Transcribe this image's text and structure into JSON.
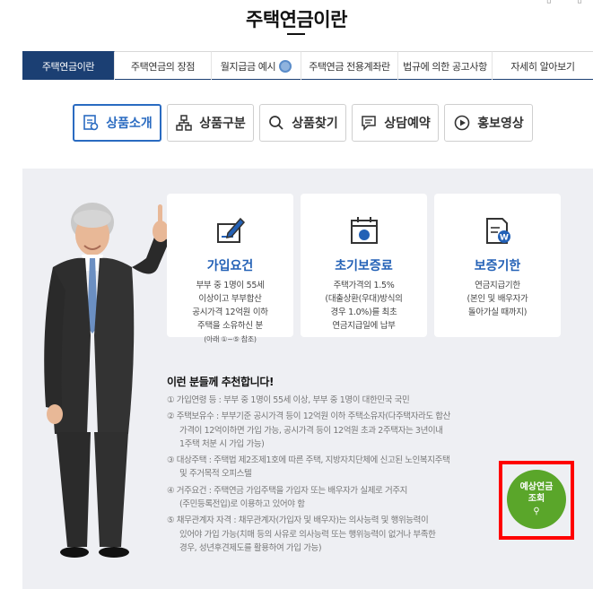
{
  "page": {
    "title": "주택연금이란"
  },
  "tabs": [
    {
      "label": "주택연금이란",
      "active": true
    },
    {
      "label": "주택연금의 장점",
      "active": false
    },
    {
      "label": "월지급금 예시",
      "active": false,
      "icon": "medal-icon"
    },
    {
      "label": "주택연금 전용계좌란",
      "active": false
    },
    {
      "label": "법규에 의한 공고사항",
      "active": false
    },
    {
      "label": "자세히 알아보기",
      "active": false
    }
  ],
  "subtabs": [
    {
      "label": "상품소개",
      "icon": "product-doc-icon",
      "active": true
    },
    {
      "label": "상품구분",
      "icon": "hierarchy-icon",
      "active": false
    },
    {
      "label": "상품찾기",
      "icon": "search-icon",
      "active": false
    },
    {
      "label": "상담예약",
      "icon": "chat-icon",
      "active": false
    },
    {
      "label": "홍보영상",
      "icon": "play-icon",
      "active": false
    }
  ],
  "cards": [
    {
      "title": "가입요건",
      "icon": "pen-document-icon",
      "lines": [
        "부부 중 1명이 55세",
        "이상이고 부부합산",
        "공시가격 12억원 이하",
        "주택을 소유하신 분"
      ],
      "note": "(아래 ①~⑤ 참조)"
    },
    {
      "title": "초기보증료",
      "icon": "calendar-icon",
      "lines": [
        "주택가격의 1.5%",
        "(대출상환(우대)방식의",
        "경우 1.0%)를 최초",
        "연금지급일에 납부"
      ]
    },
    {
      "title": "보증기한",
      "icon": "won-document-icon",
      "lines": [
        "연금지급기한",
        "(본인 및 배우자가",
        "돌아가실 때까지)"
      ]
    }
  ],
  "recommend": {
    "title": "이런 분들께 추천합니다!",
    "items": [
      {
        "lines": [
          "① 가입연령 등 : 부부 중 1명이 55세 이상, 부부 중 1명이 대한민국 국민"
        ]
      },
      {
        "lines": [
          "② 주택보유수 : 부부기준 공시가격 등이 12억원 이하 주택소유자(다주택자라도 합산",
          "가격이 12억이하면 가입 가능, 공시가격 등이 12억원 초과 2주택자는 3년이내",
          "1주택 처분 시 가입 가능)"
        ]
      },
      {
        "lines": [
          "③ 대상주택 : 주택법 제2조제1호에 따른 주택, 지방자치단체에 신고된 노인복지주택",
          "및 주거목적 오피스텔"
        ]
      },
      {
        "lines": [
          "④ 거주요건 : 주택연금 가입주택을 가입자 또는 배우자가 실제로 거주지",
          "(주민등록전입)로 이용하고 있어야 함"
        ]
      },
      {
        "lines": [
          "⑤ 채무관계자 자격 : 채무관계자(가입자 및 배우자)는 의사능력 및 행위능력이",
          "있어야 가입 가능(치매 등의 사유로 의사능력 또는 행위능력이 없거나 부족한",
          "경우, 성년후견제도를 활용하여 가입 가능)"
        ]
      }
    ]
  },
  "predict_button": {
    "line1": "예상연금",
    "line2": "조회",
    "icon": "magnifier-icon"
  },
  "colors": {
    "navy": "#1b3f73",
    "accent_blue": "#2361b6",
    "button_green": "#5aa62a",
    "highlight_red": "#ff0000",
    "panel_bg": "#eeeff3"
  }
}
